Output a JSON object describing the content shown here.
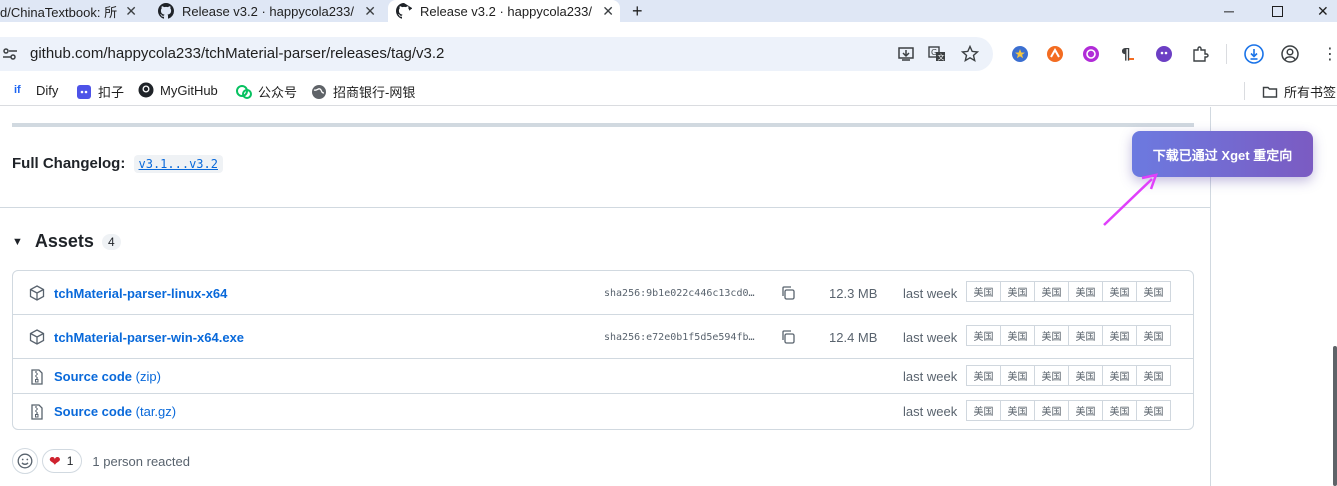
{
  "browser": {
    "tabs": [
      {
        "title": "d/ChinaTextbook: 所",
        "active": false
      },
      {
        "title": "Release v3.2 · happycola233/",
        "active": false
      },
      {
        "title": "Release v3.2 · happycola233/",
        "active": true
      }
    ],
    "new_tab": "+",
    "address": "github.com/happycola233/tchMaterial-parser/releases/tag/v3.2",
    "bookmarks": [
      {
        "label": "Dify",
        "icon": "dify-icon"
      },
      {
        "label": "扣子",
        "icon": "coze-icon"
      },
      {
        "label": "MyGitHub",
        "icon": "github-icon"
      },
      {
        "label": "公众号",
        "icon": "wechat-icon"
      },
      {
        "label": "招商银行-网银",
        "icon": "globe-icon"
      }
    ],
    "all_bookmarks": "所有书签",
    "colors": {
      "tabbar": "#dfe7f5",
      "omnibox": "#edf2fa"
    }
  },
  "release": {
    "changelog_label": "Full Changelog:",
    "changelog_link": "v3.1...v3.2",
    "assets_title": "Assets",
    "assets_count": "4",
    "assets": [
      {
        "name": "tchMaterial-parser-linux-x64",
        "suffix": "",
        "icon": "package-icon",
        "sha": "sha256:9b1e022c446c13cd0…",
        "size": "12.3 MB",
        "when": "last week"
      },
      {
        "name": "tchMaterial-parser-win-x64.exe",
        "suffix": "",
        "icon": "package-icon",
        "sha": "sha256:e72e0b1f5d5e594fb…",
        "size": "12.4 MB",
        "when": "last week"
      },
      {
        "name": "Source code",
        "suffix": " (zip)",
        "icon": "file-zip-icon",
        "sha": "",
        "size": "",
        "when": "last week"
      },
      {
        "name": "Source code",
        "suffix": " (tar.gz)",
        "icon": "file-zip-icon",
        "sha": "",
        "size": "",
        "when": "last week"
      }
    ],
    "mirror_label": "美国",
    "reaction_count": "1",
    "reacted_text": "1 person reacted"
  },
  "toast": {
    "text": "下载已通过 Xget 重定向",
    "colors": {
      "from": "#6c7ae0",
      "to": "#7b5bc2",
      "arrow": "#e040fb"
    }
  }
}
